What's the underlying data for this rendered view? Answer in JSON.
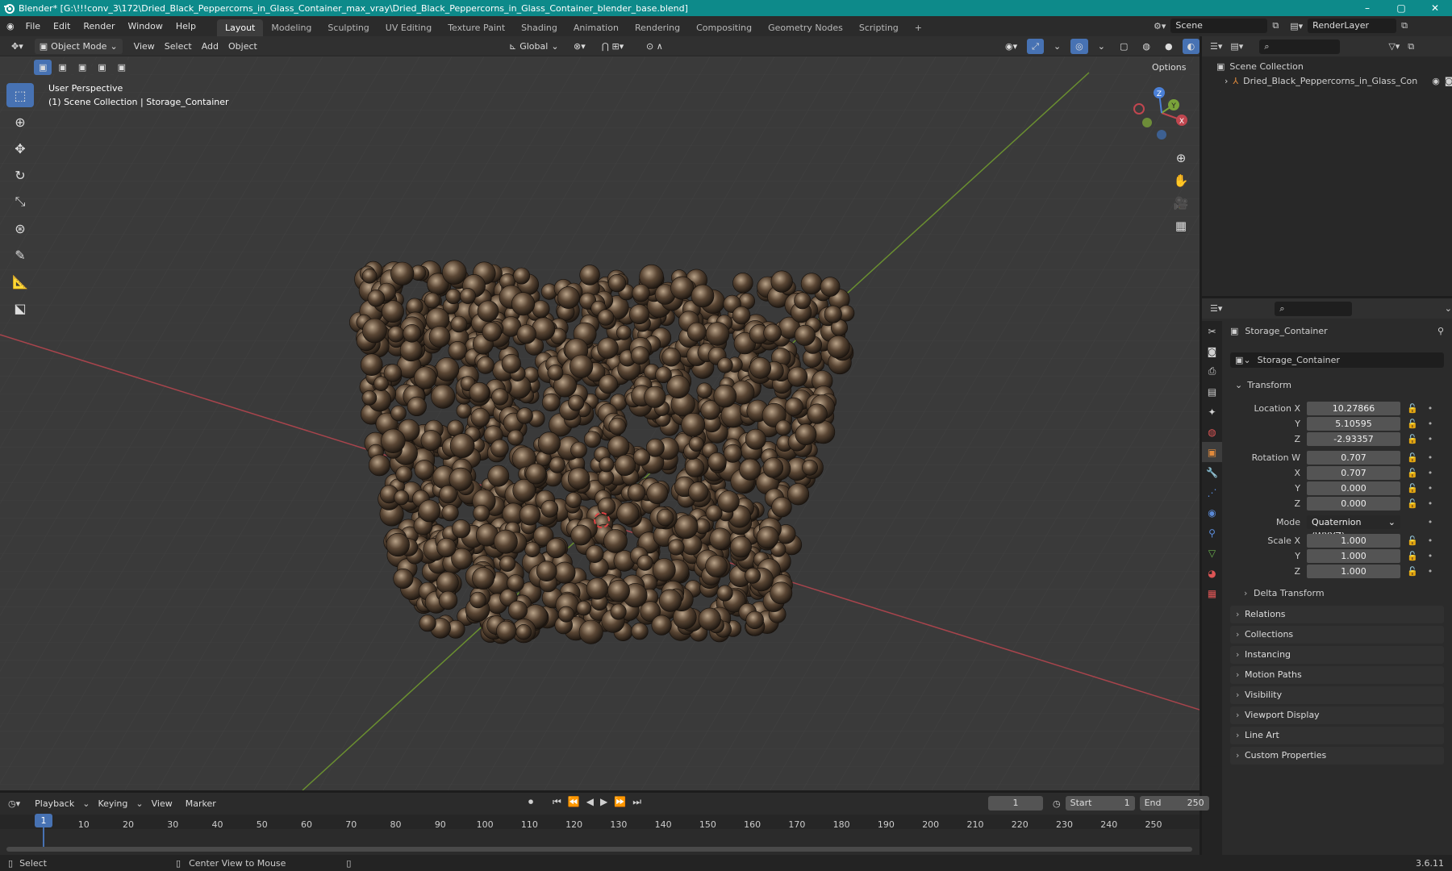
{
  "titlebar": {
    "title": "Blender* [G:\\!!!conv_3\\172\\Dried_Black_Peppercorns_in_Glass_Container_max_vray\\Dried_Black_Peppercorns_in_Glass_Container_blender_base.blend]"
  },
  "menu": [
    "File",
    "Edit",
    "Render",
    "Window",
    "Help"
  ],
  "workspaces": [
    "Layout",
    "Modeling",
    "Sculpting",
    "UV Editing",
    "Texture Paint",
    "Shading",
    "Animation",
    "Rendering",
    "Compositing",
    "Geometry Nodes",
    "Scripting"
  ],
  "scene": {
    "name": "Scene",
    "render_layer": "RenderLayer"
  },
  "viewport_header": {
    "mode": "Object Mode",
    "menus": [
      "View",
      "Select",
      "Add",
      "Object"
    ],
    "orientation": "Global",
    "options": "Options"
  },
  "viewport": {
    "perspective": "User Perspective",
    "collection_info": "(1) Scene Collection | Storage_Container"
  },
  "gizmo": {
    "x": "X",
    "y": "Y",
    "z": "Z"
  },
  "outliner": {
    "root": "Scene Collection",
    "item": "Dried_Black_Peppercorns_in_Glass_Con"
  },
  "properties": {
    "object_name": "Storage_Container",
    "data_name": "Storage_Container",
    "transform_label": "Transform",
    "location": {
      "label": "Location X",
      "x": "10.27866",
      "y": "5.10595",
      "z": "-2.93357"
    },
    "rotation": {
      "label": "Rotation W",
      "w": "0.707",
      "x": "0.707",
      "y": "0.000",
      "z": "0.000"
    },
    "mode_label": "Mode",
    "mode_value": "Quaternion (WXYZ)",
    "scale": {
      "label": "Scale X",
      "x": "1.000",
      "y": "1.000",
      "z": "1.000"
    },
    "axis_y": "Y",
    "axis_z": "Z",
    "axis_x": "X",
    "delta": "Delta Transform",
    "panels": [
      "Relations",
      "Collections",
      "Instancing",
      "Motion Paths",
      "Visibility",
      "Viewport Display",
      "Line Art",
      "Custom Properties"
    ]
  },
  "timeline": {
    "menus": [
      "Playback",
      "Keying",
      "View",
      "Marker"
    ],
    "current_frame": "1",
    "start_label": "Start",
    "start": "1",
    "end_label": "End",
    "end": "250",
    "ticks": [
      "1",
      "10",
      "20",
      "30",
      "40",
      "50",
      "60",
      "70",
      "80",
      "90",
      "100",
      "110",
      "120",
      "130",
      "140",
      "150",
      "160",
      "170",
      "180",
      "190",
      "200",
      "210",
      "220",
      "230",
      "240",
      "250"
    ]
  },
  "statusbar": {
    "select": "Select",
    "center": "Center View to Mouse",
    "version": "3.6.11"
  },
  "colors": {
    "accent": "#4772b3",
    "titlebar": "#0d8a8a",
    "x_axis": "#c0464f",
    "y_axis": "#7aa33a"
  }
}
